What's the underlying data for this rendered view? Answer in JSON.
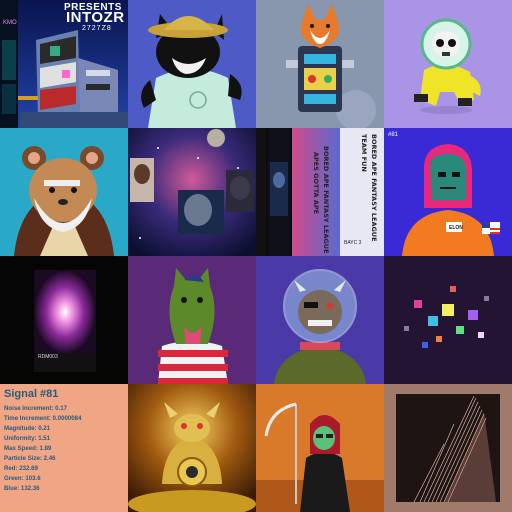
{
  "gallery": {
    "tile1": {
      "top_text": "PRESENTS",
      "title": "INTOZR",
      "subtitle": "2727Z8",
      "side_text": "KMO"
    },
    "tile7": {
      "headline": "APES GOTTA APE",
      "subline": "BORED APE FANTASY LEAGUE",
      "team_label": "TEAM FUN",
      "side_caption": "BORED APE FANTASY LEAGUE",
      "footer": "BAYC 3"
    },
    "tile8": {
      "number": "#81",
      "badge": "ELON"
    },
    "tile9": {
      "code": "RDM003"
    },
    "tile13": {
      "title": "Signal #81",
      "rows": [
        "Noise Increment: 0.17",
        "Time Increment: 0.0000084",
        "Magnitude: 0.21",
        "Uniformity: 1.51",
        "Max Speed: 1.89",
        "Particle Size: 2.46",
        "Red: 232.69",
        "Green: 103.6",
        "Blue: 132.36"
      ]
    }
  }
}
